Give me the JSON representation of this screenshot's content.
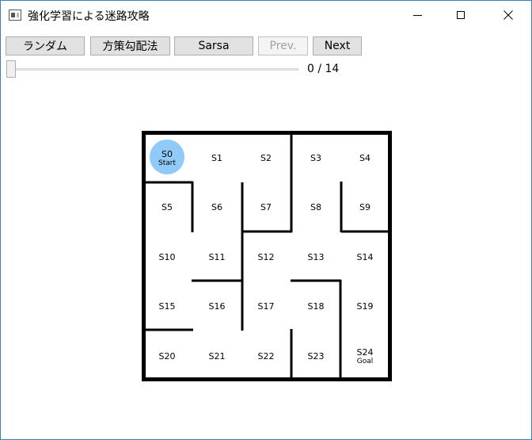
{
  "window": {
    "title": "強化学習による迷路攻略"
  },
  "toolbar": {
    "random_label": "ランダム",
    "policy_gradient_label": "方策勾配法",
    "sarsa_label": "Sarsa",
    "prev_label": "Prev.",
    "next_label": "Next"
  },
  "progress": {
    "readout": "0 / 14",
    "current_step": 0,
    "total_steps": 14
  },
  "maze": {
    "agent_state": "S0",
    "agent_color": "#90caf9",
    "cells": [
      {
        "label": "S0",
        "sub": "Start"
      },
      {
        "label": "S1",
        "sub": ""
      },
      {
        "label": "S2",
        "sub": ""
      },
      {
        "label": "S3",
        "sub": ""
      },
      {
        "label": "S4",
        "sub": ""
      },
      {
        "label": "S5",
        "sub": ""
      },
      {
        "label": "S6",
        "sub": ""
      },
      {
        "label": "S7",
        "sub": ""
      },
      {
        "label": "S8",
        "sub": ""
      },
      {
        "label": "S9",
        "sub": ""
      },
      {
        "label": "S10",
        "sub": ""
      },
      {
        "label": "S11",
        "sub": ""
      },
      {
        "label": "S12",
        "sub": ""
      },
      {
        "label": "S13",
        "sub": ""
      },
      {
        "label": "S14",
        "sub": ""
      },
      {
        "label": "S15",
        "sub": ""
      },
      {
        "label": "S16",
        "sub": ""
      },
      {
        "label": "S17",
        "sub": ""
      },
      {
        "label": "S18",
        "sub": ""
      },
      {
        "label": "S19",
        "sub": ""
      },
      {
        "label": "S20",
        "sub": ""
      },
      {
        "label": "S21",
        "sub": ""
      },
      {
        "label": "S22",
        "sub": ""
      },
      {
        "label": "S23",
        "sub": ""
      },
      {
        "label": "S24",
        "sub": "Goal"
      }
    ]
  }
}
